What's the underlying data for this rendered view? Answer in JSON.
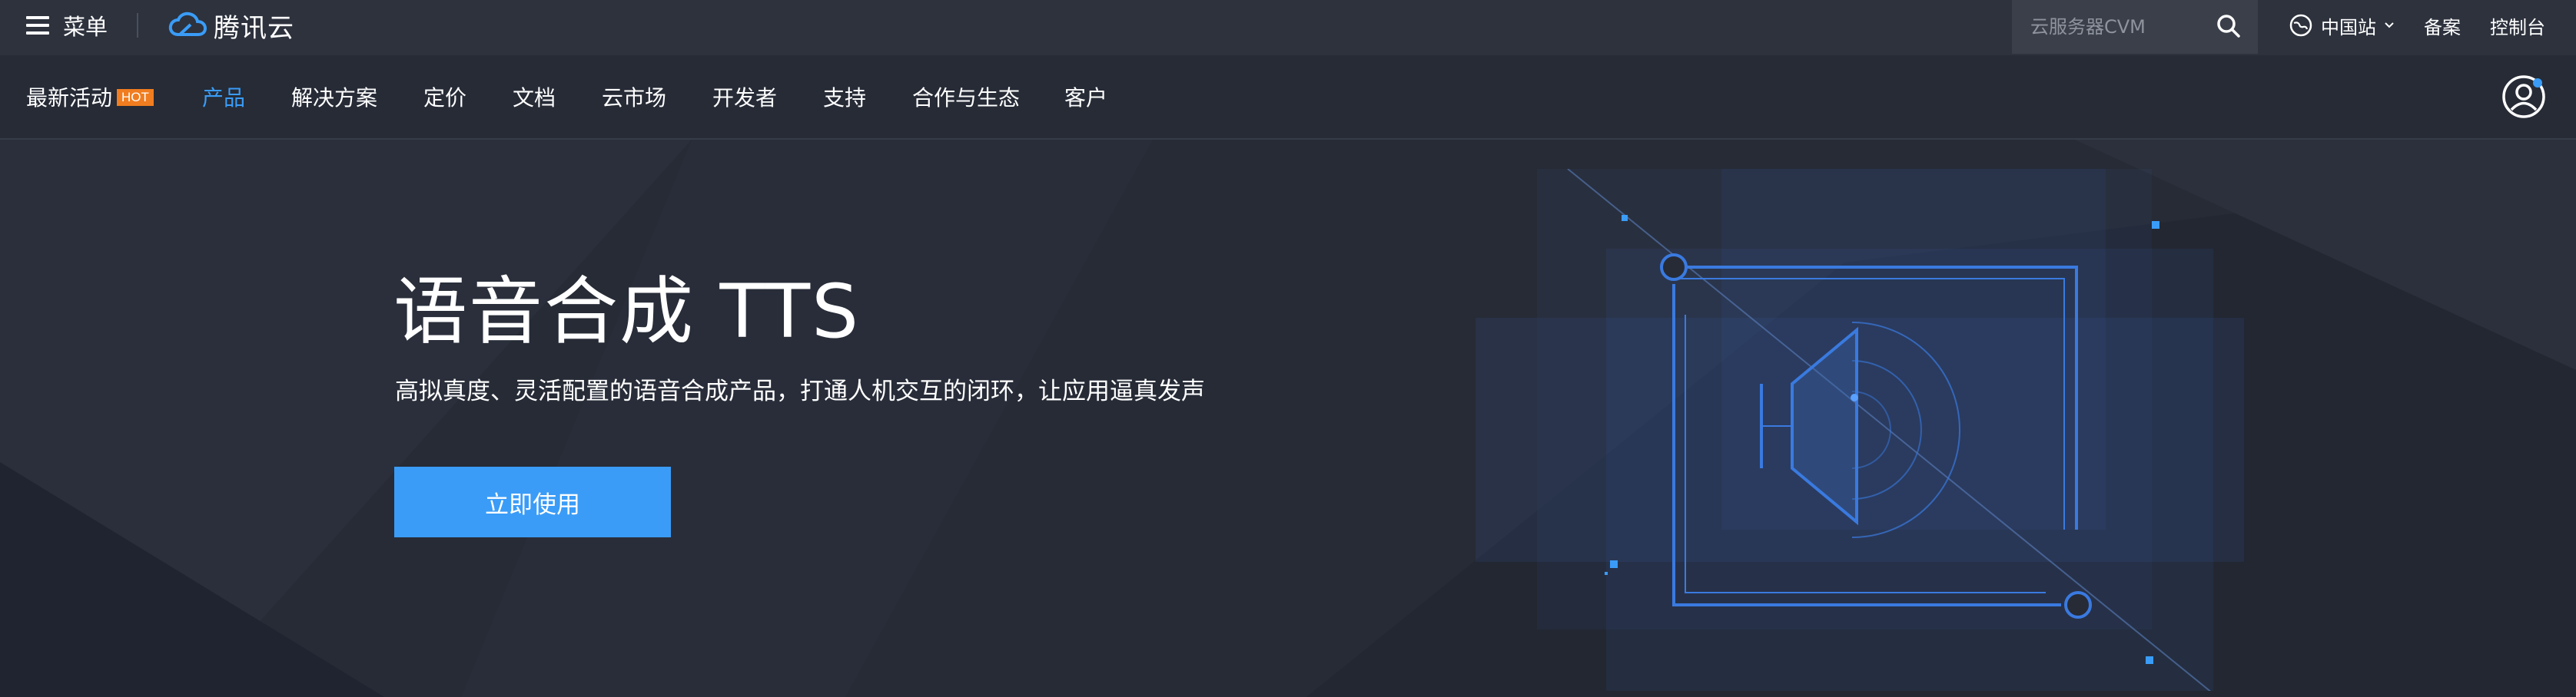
{
  "topbar": {
    "menu_label": "菜单",
    "logo_text": "腾讯云",
    "search_placeholder": "云服务器CVM",
    "region_label": "中国站",
    "beian_label": "备案",
    "console_label": "控制台"
  },
  "nav": {
    "items": [
      {
        "label": "最新活动",
        "badge": "HOT"
      },
      {
        "label": "产品"
      },
      {
        "label": "解决方案"
      },
      {
        "label": "定价"
      },
      {
        "label": "文档"
      },
      {
        "label": "云市场"
      },
      {
        "label": "开发者"
      },
      {
        "label": "支持"
      },
      {
        "label": "合作与生态"
      },
      {
        "label": "客户"
      }
    ],
    "active_index": 1
  },
  "hero": {
    "title": "语音合成 TTS",
    "subtitle": "高拟真度、灵活配置的语音合成产品，打通人机交互的闭环，让应用逼真发声",
    "cta_label": "立即使用"
  },
  "colors": {
    "accent": "#3a9cf7",
    "hot_badge": "#f07d1f",
    "topbar_bg": "#2d323d",
    "page_bg": "#262b36"
  },
  "icons": [
    "menu-icon",
    "tencent-cloud-logo-icon",
    "search-icon",
    "globe-icon",
    "chevron-down-icon",
    "user-avatar-icon",
    "speaker-icon"
  ]
}
